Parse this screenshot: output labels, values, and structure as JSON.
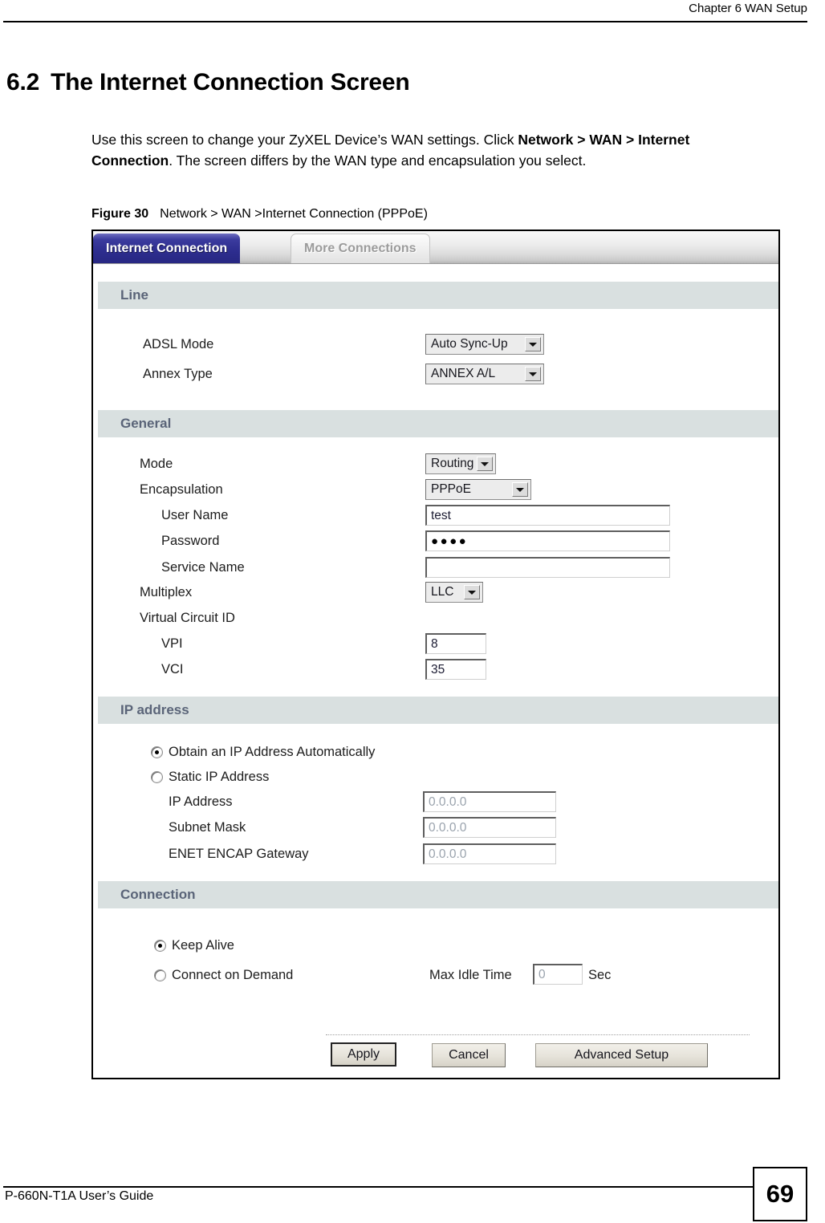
{
  "page_header": {
    "chapter": "Chapter 6 WAN Setup"
  },
  "heading": {
    "number": "6.2",
    "title": "The Internet Connection Screen"
  },
  "intro": {
    "part1": "Use this screen to change your ZyXEL Device’s WAN settings. Click ",
    "bold1": "Network > WAN > Internet Connection",
    "part2": ". The screen differs by the WAN type and encapsulation you select."
  },
  "figure": {
    "label": "Figure 30",
    "caption": "Network > WAN >Internet Connection (PPPoE)"
  },
  "screen": {
    "tabs": [
      {
        "label": "Internet Connection",
        "active": true
      },
      {
        "label": "More Connections",
        "active": false
      }
    ],
    "sections": {
      "line": {
        "title": "Line",
        "adsl_mode": {
          "label": "ADSL Mode",
          "value": "Auto Sync-Up"
        },
        "annex_type": {
          "label": "Annex Type",
          "value": "ANNEX A/L"
        }
      },
      "general": {
        "title": "General",
        "mode": {
          "label": "Mode",
          "value": "Routing"
        },
        "encapsulation": {
          "label": "Encapsulation",
          "value": "PPPoE"
        },
        "user_name": {
          "label": "User Name",
          "value": "test"
        },
        "password": {
          "label": "Password",
          "value": "●●●●"
        },
        "service_name": {
          "label": "Service Name",
          "value": ""
        },
        "multiplex": {
          "label": "Multiplex",
          "value": "LLC"
        },
        "virtual_circuit_id": {
          "label": "Virtual Circuit ID"
        },
        "vpi": {
          "label": "VPI",
          "value": "8"
        },
        "vci": {
          "label": "VCI",
          "value": "35"
        }
      },
      "ip_address": {
        "title": "IP address",
        "obtain_auto": {
          "label": "Obtain an IP Address Automatically",
          "selected": true
        },
        "static_ip": {
          "label": "Static IP Address",
          "selected": false
        },
        "ip_address": {
          "label": "IP Address",
          "value": "0.0.0.0"
        },
        "subnet_mask": {
          "label": "Subnet Mask",
          "value": "0.0.0.0"
        },
        "enet_encap_gateway": {
          "label": "ENET ENCAP Gateway",
          "value": "0.0.0.0"
        }
      },
      "connection": {
        "title": "Connection",
        "keep_alive": {
          "label": "Keep Alive",
          "selected": true
        },
        "connect_on_demand": {
          "label": "Connect on Demand",
          "selected": false
        },
        "max_idle_time": {
          "label": "Max Idle Time",
          "value": "0",
          "unit": "Sec"
        }
      }
    },
    "buttons": {
      "apply": "Apply",
      "cancel": "Cancel",
      "advanced_setup": "Advanced Setup"
    }
  },
  "footer": {
    "guide": "P-660N-T1A User’s Guide",
    "page_number": "69"
  },
  "colors": {
    "active_tab": "#2d2d8e",
    "band": "#d9e0e0",
    "band_text": "#5a6478"
  }
}
